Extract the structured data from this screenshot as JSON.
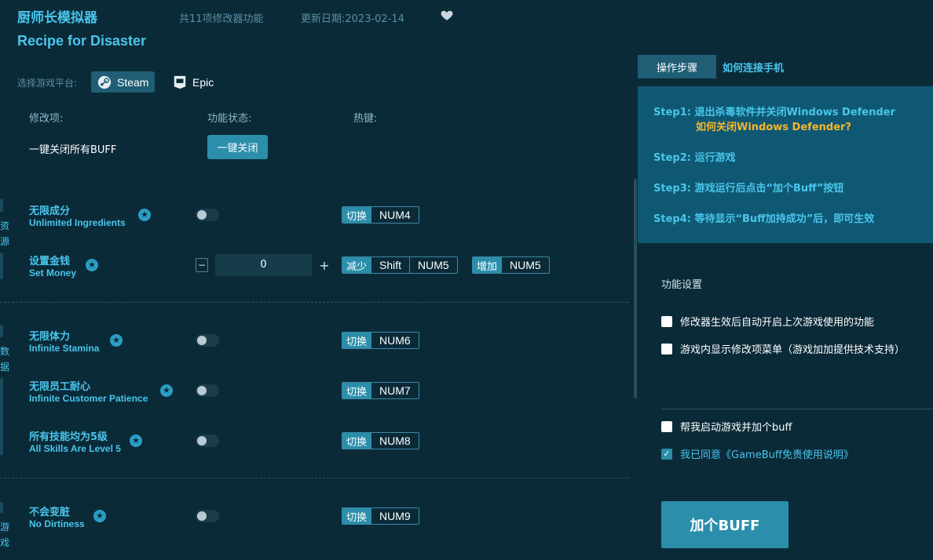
{
  "header": {
    "title_cn": "厨师长模拟器",
    "title_en": "Recipe for Disaster",
    "feature_count": "共11项修改器功能",
    "update_date": "更新日期:2023-02-14"
  },
  "platform": {
    "label": "选择游戏平台:",
    "options": [
      {
        "label": "Steam",
        "selected": true
      },
      {
        "label": "Epic",
        "selected": false
      }
    ]
  },
  "columns": {
    "item": "修改项:",
    "status": "功能状态:",
    "hotkey": "热键:"
  },
  "close_all": {
    "label": "一键关闭所有BUFF",
    "button": "一键关闭"
  },
  "side_tabs": {
    "resource": [
      "资",
      "源"
    ],
    "data": [
      "数",
      "据"
    ],
    "game": [
      "游",
      "戏"
    ]
  },
  "items": [
    {
      "cn": "无限成分",
      "en": "Unlimited Ingredients",
      "hotkey_label": "切换",
      "hotkey": "NUM4",
      "on": false
    },
    {
      "cn": "设置金钱",
      "en": "Set Money",
      "value": "0",
      "decrease_label": "减少",
      "decrease_keys": [
        "Shift",
        "NUM5"
      ],
      "increase_label": "增加",
      "increase_keys": [
        "NUM5"
      ]
    },
    {
      "cn": "无限体力",
      "en": "Infinite Stamina",
      "hotkey_label": "切换",
      "hotkey": "NUM6",
      "on": false
    },
    {
      "cn": "无限员工耐心",
      "en": "Infinite Customer Patience",
      "hotkey_label": "切换",
      "hotkey": "NUM7",
      "on": false
    },
    {
      "cn": "所有技能均为5级",
      "en": "All Skills Are Level 5",
      "hotkey_label": "切换",
      "hotkey": "NUM8",
      "on": false
    },
    {
      "cn": "不会变脏",
      "en": "No Dirtiness",
      "hotkey_label": "切换",
      "hotkey": "NUM9",
      "on": false
    }
  ],
  "stepper": {
    "minus": "−",
    "plus": "+"
  },
  "right_panel": {
    "tabs": [
      "操作步骤",
      "如何连接手机"
    ],
    "steps": [
      "Step1:  退出杀毒软件并关闭Windows Defender",
      "Step2:  运行游戏",
      "Step3:  游戏运行后点击“加个Buff”按钮",
      "Step4:  等待显示“Buff加持成功”后，即可生效"
    ],
    "step1_link": "如何关闭Windows Defender?",
    "settings_title": "功能设置",
    "settings": [
      {
        "label": "修改器生效后自动开启上次游戏使用的功能",
        "checked": false
      },
      {
        "label": "游戏内显示修改项菜单（游戏加加提供技术支持）",
        "checked": false
      }
    ],
    "auto_launch": {
      "label": "帮我启动游戏并加个buff",
      "checked": false
    },
    "agree": {
      "label": "我已同意《GameBuff免责使用说明》",
      "checked": true
    },
    "add_button": "加个BUFF"
  },
  "colors": {
    "background": "#0b2a38",
    "accent": "#49c6ec",
    "button": "#2b8eaa",
    "link": "#f5b62f"
  }
}
